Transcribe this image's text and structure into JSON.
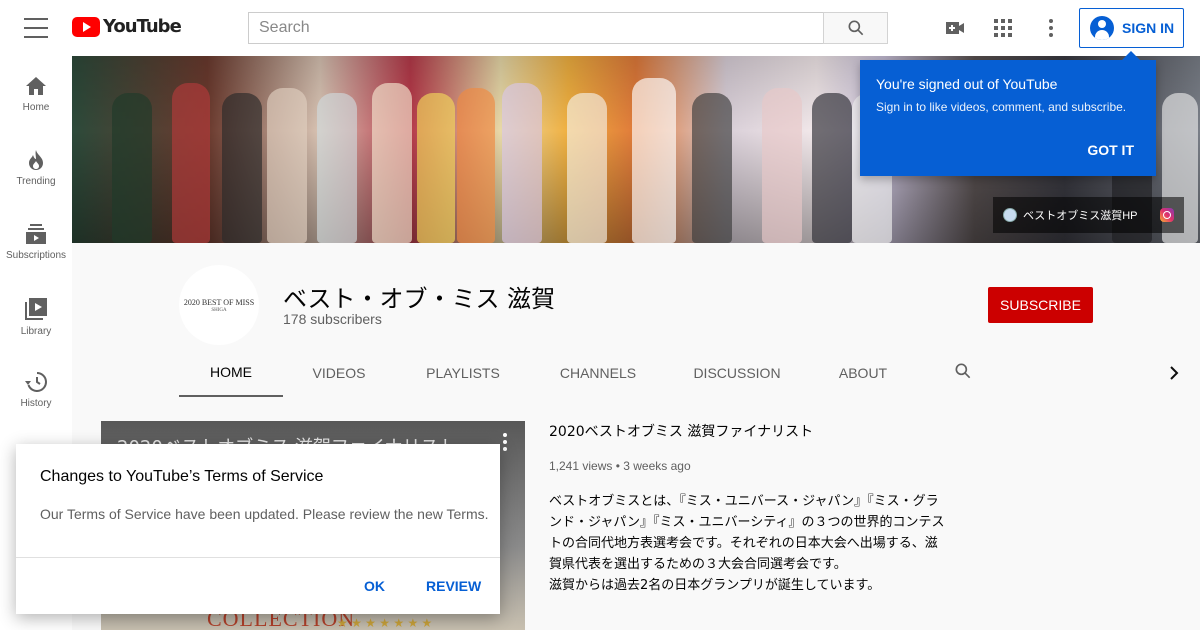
{
  "app": {
    "logo_text": "YouTube"
  },
  "search": {
    "placeholder": "Search",
    "value": ""
  },
  "header": {
    "signin_label": "SIGN IN"
  },
  "sidebar": {
    "items": [
      {
        "label": "Home",
        "icon": "home-icon"
      },
      {
        "label": "Trending",
        "icon": "trending-icon"
      },
      {
        "label": "Subscriptions",
        "icon": "subscriptions-icon"
      },
      {
        "label": "Library",
        "icon": "library-icon"
      },
      {
        "label": "History",
        "icon": "history-icon"
      }
    ]
  },
  "banner": {
    "link_label": "ベストオブミス滋賀HP"
  },
  "tooltip": {
    "title": "You're signed out of YouTube",
    "body": "Sign in to like videos, comment, and subscribe.",
    "button": "GOT IT"
  },
  "channel": {
    "name": "ベスト・オブ・ミス 滋賀",
    "subscribers": "178 subscribers",
    "avatar_text": "2020 BEST OF MISS",
    "avatar_subtext": "SHIGA",
    "subscribe_label": "SUBSCRIBE",
    "tabs": [
      "HOME",
      "VIDEOS",
      "PLAYLISTS",
      "CHANNELS",
      "DISCUSSION",
      "ABOUT"
    ],
    "active_tab": "HOME"
  },
  "featured_video": {
    "thumb_title": "2020ベストオブミス 滋賀ファイナリスト",
    "thumb_overlay": "COLLECTION",
    "thumb_stars": "★ ★ ★ ★ ★ ★ ★",
    "title": "2020ベストオブミス 滋賀ファイナリスト",
    "meta": "1,241 views • 3 weeks ago",
    "description": "ベストオブミスとは、『ミス・ユニバース・ジャパン』『ミス・グランド・ジャパン』『ミス・ユニバーシティ』の３つの世界的コンテストの合同代地方表選考会です。それぞれの日本大会へ出場する、滋賀県代表を選出するための３大会合同選考会です。\n滋賀からは過去2名の日本グランプリが誕生しています。"
  },
  "dialog": {
    "title": "Changes to YouTube’s Terms of Service",
    "body": "Our Terms of Service have been updated. Please review the new Terms.",
    "ok_label": "OK",
    "review_label": "REVIEW"
  },
  "colors": {
    "brand_red": "#ff0000",
    "accent_blue": "#065fd4",
    "subscribe_red": "#cc0000"
  }
}
